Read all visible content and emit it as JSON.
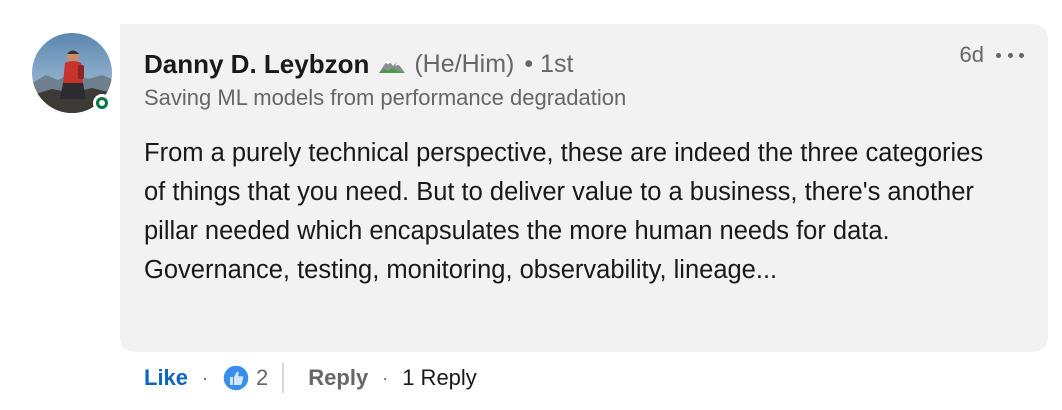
{
  "comment": {
    "author": "Danny D. Leybzon",
    "author_badge_icon": "mountain-emoji-icon",
    "pronouns": "(He/Him)",
    "degree": "• 1st",
    "headline": "Saving ML models from performance degradation",
    "time": "6d",
    "text": "From a purely technical perspective, these are indeed the three categories of things that you need. But to deliver value to a business, there's another pillar needed which encapsulates the more human needs for data. Governance, testing, monitoring, observability, lineage...",
    "online": true
  },
  "actions": {
    "like_label": "Like",
    "separator": "·",
    "reaction_icon": "thumbs-up-icon",
    "reaction_count": "2",
    "reply_label": "Reply",
    "replies_label": "1 Reply"
  },
  "colors": {
    "link_blue": "#0a66c2",
    "bubble_bg": "#f2f2f2",
    "muted_text": "#666666",
    "presence_green": "#057642"
  }
}
